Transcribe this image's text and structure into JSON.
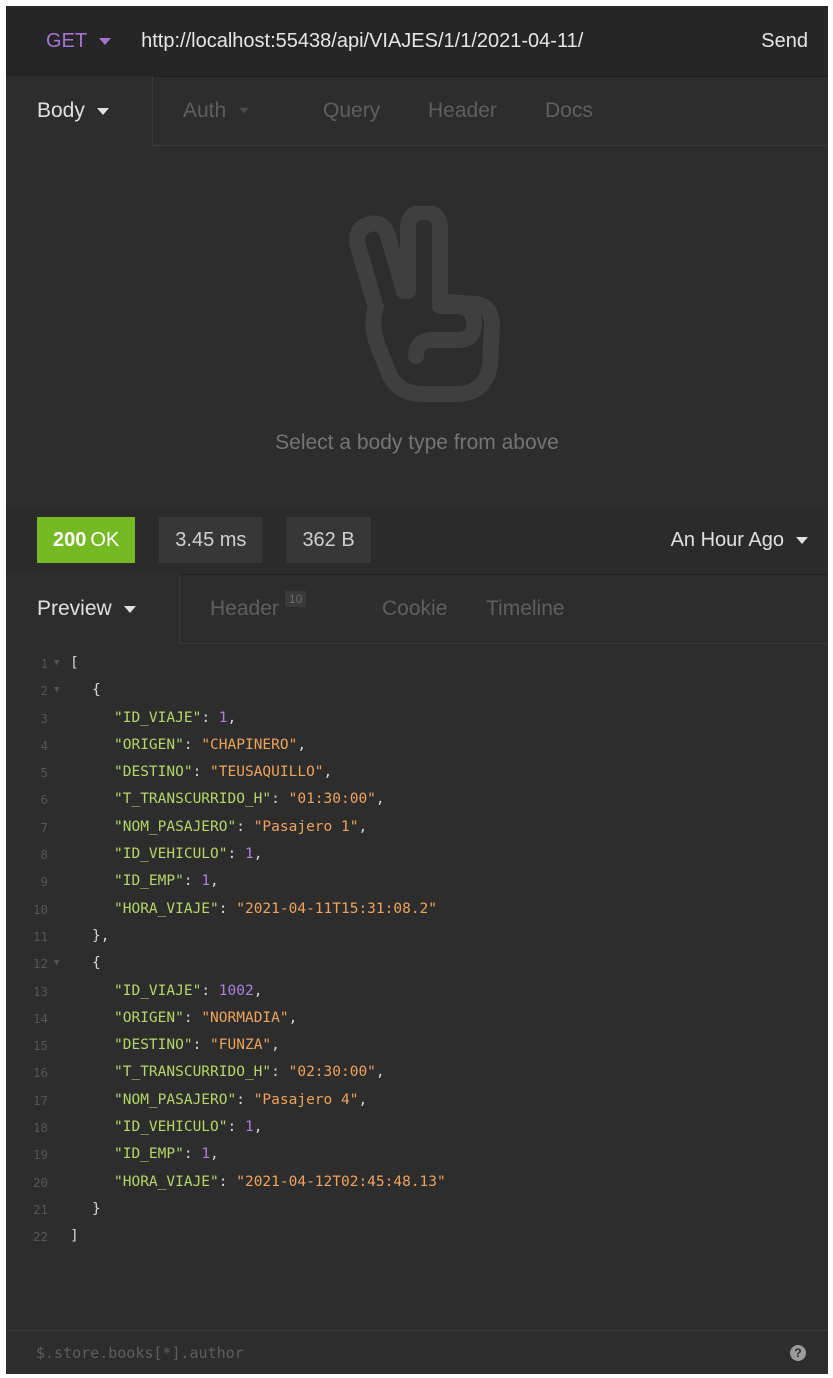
{
  "url_bar": {
    "method": "GET",
    "url": "http://localhost:55438/api/VIAJES/1/1/2021-04-11/",
    "send_label": "Send"
  },
  "request_tabs": [
    {
      "label": "Body",
      "active": true,
      "dropdown": true
    },
    {
      "label": "Auth",
      "active": false,
      "dropdown": true
    },
    {
      "label": "Query",
      "active": false
    },
    {
      "label": "Header",
      "active": false
    },
    {
      "label": "Docs",
      "active": false
    }
  ],
  "request_body": {
    "empty_icon": "peace-hand-icon",
    "empty_message": "Select a body type from above"
  },
  "response": {
    "status_code": "200",
    "status_text": "OK",
    "time": "3.45 ms",
    "size": "362 B",
    "history": "An Hour Ago"
  },
  "response_tabs": [
    {
      "label": "Preview",
      "active": true,
      "dropdown": true
    },
    {
      "label": "Header",
      "badge": "10",
      "active": false
    },
    {
      "label": "Cookie",
      "active": false
    },
    {
      "label": "Timeline",
      "active": false
    }
  ],
  "code_lines": [
    {
      "num": "1",
      "fold": true,
      "indent": 0,
      "tokens": [
        {
          "t": "p",
          "v": "["
        }
      ]
    },
    {
      "num": "2",
      "fold": true,
      "indent": 1,
      "tokens": [
        {
          "t": "p",
          "v": "{"
        }
      ]
    },
    {
      "num": "3",
      "indent": 2,
      "tokens": [
        {
          "t": "k",
          "v": "\"ID_VIAJE\""
        },
        {
          "t": "p",
          "v": ": "
        },
        {
          "t": "n",
          "v": "1"
        },
        {
          "t": "p",
          "v": ","
        }
      ]
    },
    {
      "num": "4",
      "indent": 2,
      "tokens": [
        {
          "t": "k",
          "v": "\"ORIGEN\""
        },
        {
          "t": "p",
          "v": ": "
        },
        {
          "t": "s",
          "v": "\"CHAPINERO\""
        },
        {
          "t": "p",
          "v": ","
        }
      ]
    },
    {
      "num": "5",
      "indent": 2,
      "tokens": [
        {
          "t": "k",
          "v": "\"DESTINO\""
        },
        {
          "t": "p",
          "v": ": "
        },
        {
          "t": "s",
          "v": "\"TEUSAQUILLO\""
        },
        {
          "t": "p",
          "v": ","
        }
      ]
    },
    {
      "num": "6",
      "indent": 2,
      "tokens": [
        {
          "t": "k",
          "v": "\"T_TRANSCURRIDO_H\""
        },
        {
          "t": "p",
          "v": ": "
        },
        {
          "t": "s",
          "v": "\"01:30:00\""
        },
        {
          "t": "p",
          "v": ","
        }
      ]
    },
    {
      "num": "7",
      "indent": 2,
      "tokens": [
        {
          "t": "k",
          "v": "\"NOM_PASAJERO\""
        },
        {
          "t": "p",
          "v": ": "
        },
        {
          "t": "s",
          "v": "\"Pasajero 1\""
        },
        {
          "t": "p",
          "v": ","
        }
      ]
    },
    {
      "num": "8",
      "indent": 2,
      "tokens": [
        {
          "t": "k",
          "v": "\"ID_VEHICULO\""
        },
        {
          "t": "p",
          "v": ": "
        },
        {
          "t": "n",
          "v": "1"
        },
        {
          "t": "p",
          "v": ","
        }
      ]
    },
    {
      "num": "9",
      "indent": 2,
      "tokens": [
        {
          "t": "k",
          "v": "\"ID_EMP\""
        },
        {
          "t": "p",
          "v": ": "
        },
        {
          "t": "n",
          "v": "1"
        },
        {
          "t": "p",
          "v": ","
        }
      ]
    },
    {
      "num": "10",
      "indent": 2,
      "tokens": [
        {
          "t": "k",
          "v": "\"HORA_VIAJE\""
        },
        {
          "t": "p",
          "v": ": "
        },
        {
          "t": "s",
          "v": "\"2021-04-11T15:31:08.2\""
        }
      ]
    },
    {
      "num": "11",
      "indent": 1,
      "tokens": [
        {
          "t": "p",
          "v": "},"
        }
      ]
    },
    {
      "num": "12",
      "fold": true,
      "indent": 1,
      "tokens": [
        {
          "t": "p",
          "v": "{"
        }
      ]
    },
    {
      "num": "13",
      "indent": 2,
      "tokens": [
        {
          "t": "k",
          "v": "\"ID_VIAJE\""
        },
        {
          "t": "p",
          "v": ": "
        },
        {
          "t": "n",
          "v": "1002"
        },
        {
          "t": "p",
          "v": ","
        }
      ]
    },
    {
      "num": "14",
      "indent": 2,
      "tokens": [
        {
          "t": "k",
          "v": "\"ORIGEN\""
        },
        {
          "t": "p",
          "v": ": "
        },
        {
          "t": "s",
          "v": "\"NORMADIA\""
        },
        {
          "t": "p",
          "v": ","
        }
      ]
    },
    {
      "num": "15",
      "indent": 2,
      "tokens": [
        {
          "t": "k",
          "v": "\"DESTINO\""
        },
        {
          "t": "p",
          "v": ": "
        },
        {
          "t": "s",
          "v": "\"FUNZA\""
        },
        {
          "t": "p",
          "v": ","
        }
      ]
    },
    {
      "num": "16",
      "indent": 2,
      "tokens": [
        {
          "t": "k",
          "v": "\"T_TRANSCURRIDO_H\""
        },
        {
          "t": "p",
          "v": ": "
        },
        {
          "t": "s",
          "v": "\"02:30:00\""
        },
        {
          "t": "p",
          "v": ","
        }
      ]
    },
    {
      "num": "17",
      "indent": 2,
      "tokens": [
        {
          "t": "k",
          "v": "\"NOM_PASAJERO\""
        },
        {
          "t": "p",
          "v": ": "
        },
        {
          "t": "s",
          "v": "\"Pasajero 4\""
        },
        {
          "t": "p",
          "v": ","
        }
      ]
    },
    {
      "num": "18",
      "indent": 2,
      "tokens": [
        {
          "t": "k",
          "v": "\"ID_VEHICULO\""
        },
        {
          "t": "p",
          "v": ": "
        },
        {
          "t": "n",
          "v": "1"
        },
        {
          "t": "p",
          "v": ","
        }
      ]
    },
    {
      "num": "19",
      "indent": 2,
      "tokens": [
        {
          "t": "k",
          "v": "\"ID_EMP\""
        },
        {
          "t": "p",
          "v": ": "
        },
        {
          "t": "n",
          "v": "1"
        },
        {
          "t": "p",
          "v": ","
        }
      ]
    },
    {
      "num": "20",
      "indent": 2,
      "tokens": [
        {
          "t": "k",
          "v": "\"HORA_VIAJE\""
        },
        {
          "t": "p",
          "v": ": "
        },
        {
          "t": "s",
          "v": "\"2021-04-12T02:45:48.13\""
        }
      ]
    },
    {
      "num": "21",
      "indent": 1,
      "tokens": [
        {
          "t": "p",
          "v": "}"
        }
      ]
    },
    {
      "num": "22",
      "indent": 0,
      "tokens": [
        {
          "t": "p",
          "v": "]"
        }
      ]
    }
  ],
  "footer": {
    "filter_placeholder": "$.store.books[*].author",
    "help_label": "?"
  },
  "colors": {
    "method": "#a772d6",
    "status_ok": "#75ba24",
    "json_key": "#b5d668",
    "json_string": "#f0a35c",
    "json_number": "#b07ee0"
  }
}
